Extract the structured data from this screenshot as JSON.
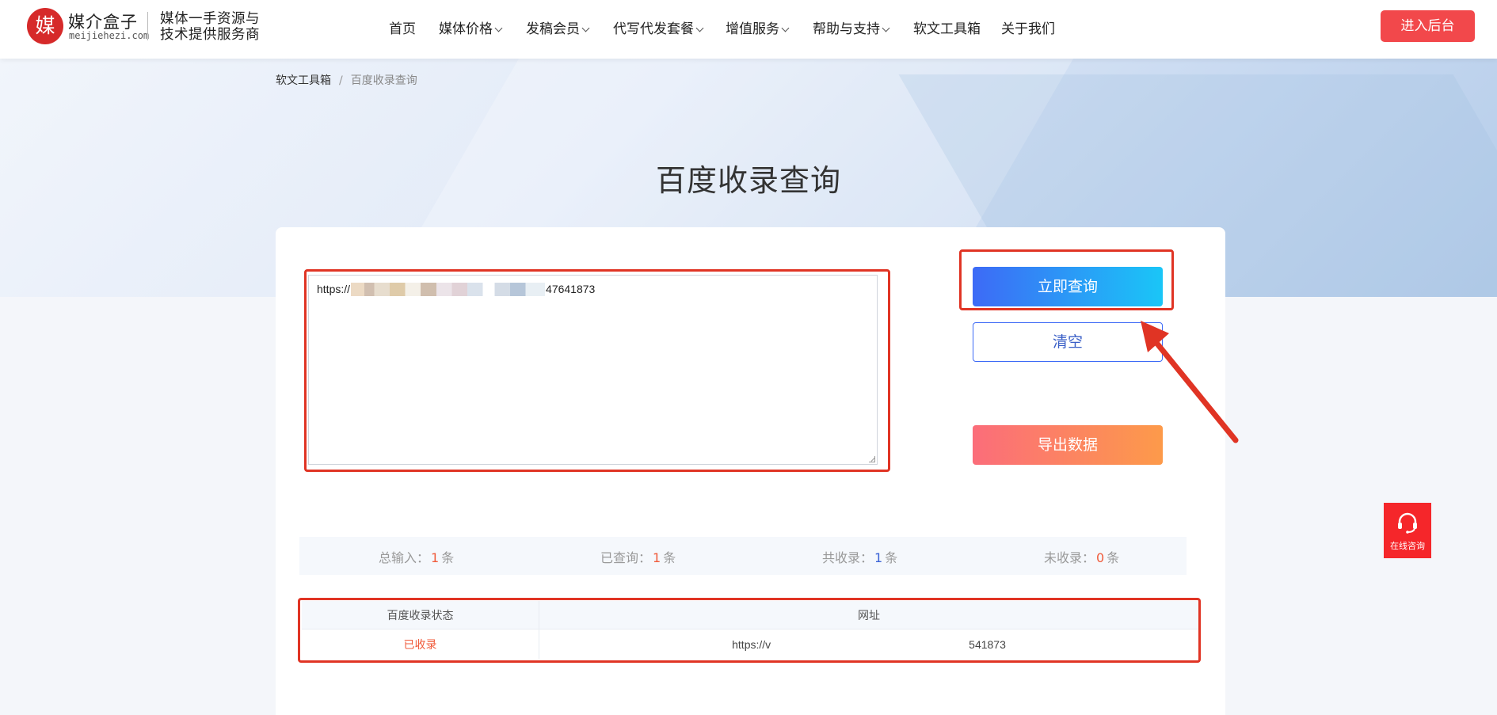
{
  "header": {
    "logo_char": "媒",
    "logo_name": "媒介盒子",
    "logo_domain": "meijiehezi.com",
    "slogan_line1": "媒体一手资源与",
    "slogan_line2": "技术提供服务商",
    "nav": [
      {
        "label": "首页"
      },
      {
        "label": "媒体价格"
      },
      {
        "label": "发稿会员"
      },
      {
        "label": "代写代发套餐"
      },
      {
        "label": "增值服务"
      },
      {
        "label": "帮助与支持"
      },
      {
        "label": "软文工具箱"
      },
      {
        "label": "关于我们"
      }
    ],
    "enter_button": "进入后台"
  },
  "breadcrumb": {
    "parent": "软文工具箱",
    "separator": "/",
    "current": "百度收录查询"
  },
  "page": {
    "title": "百度收录查询"
  },
  "input": {
    "value_prefix": "https://",
    "value_suffix": "47641873"
  },
  "buttons": {
    "query": "立即查询",
    "clear": "清空",
    "export": "导出数据"
  },
  "stats": {
    "total_label": "总输入：",
    "total_value": "1",
    "queried_label": "已查询：",
    "queried_value": "1",
    "indexed_label": "共收录：",
    "indexed_value": "1",
    "not_indexed_label": "未收录：",
    "not_indexed_value": "0",
    "unit": "条"
  },
  "table": {
    "headers": [
      "百度收录状态",
      "网址"
    ],
    "rows": [
      {
        "status": "已收录",
        "url_prefix": "https://v",
        "url_suffix": "541873"
      }
    ]
  },
  "chat_widget": {
    "label": "在线咨询",
    "icon": "headset-icon"
  },
  "colors": {
    "brand_red": "#f2484b",
    "query_gradient_start": "#3d6af6",
    "query_gradient_end": "#1ac6f7",
    "export_gradient_start": "#fb6d7a",
    "export_gradient_end": "#fd9a4a",
    "annotation_red": "#e03424",
    "status_red": "#f05a3a",
    "stat_blue": "#3b63d6"
  }
}
